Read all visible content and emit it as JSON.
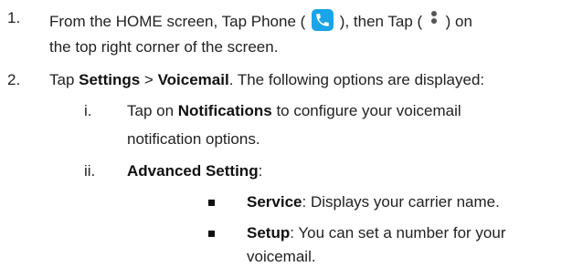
{
  "steps": [
    {
      "number": "1.",
      "text_a": "From the HOME screen, Tap Phone (",
      "text_b": "), then Tap (",
      "text_c": ") on",
      "line2": "the top right corner of the screen."
    },
    {
      "number": "2.",
      "tap": "Tap ",
      "settings": "Settings",
      "sep": " > ",
      "voicemail": "Voicemail",
      "rest": ". The following options are displayed:"
    }
  ],
  "substeps": [
    {
      "number": "i.",
      "tap_on": "Tap on ",
      "notifications": "Notifications",
      "rest": " to configure your voicemail",
      "line2": "notification options."
    },
    {
      "number": "ii.",
      "title": "Advanced Setting",
      "colon": ":"
    }
  ],
  "bullets": [
    {
      "label": "Service",
      "text": ": Displays your carrier name."
    },
    {
      "label": "Setup",
      "text": ": You can set a number for your",
      "line2": "voicemail."
    }
  ],
  "icons": {
    "phone": "phone-icon",
    "menu": "more-vert-icon",
    "phone_color": "#1aa5e8"
  }
}
